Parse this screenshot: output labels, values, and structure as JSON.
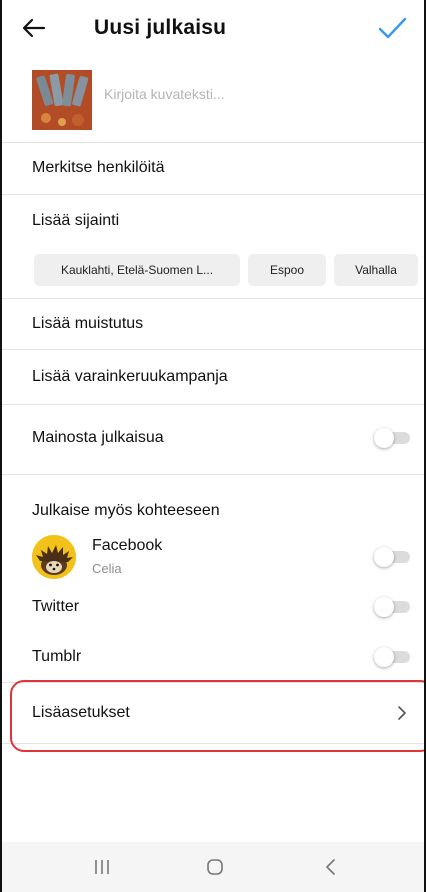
{
  "header": {
    "title": "Uusi julkaisu",
    "back_icon": "arrow-left-icon",
    "confirm_icon": "checkmark-icon",
    "accent_color": "#3897f0"
  },
  "caption": {
    "placeholder": "Kirjoita kuvateksti...",
    "value": ""
  },
  "rows": {
    "tag_people": "Merkitse henkilöitä",
    "add_location": "Lisää sijainti",
    "add_reminder": "Lisää muistutus",
    "add_fundraiser": "Lisää varainkeruukampanja",
    "promote_post": "Mainosta julkaisua",
    "advanced_settings": "Lisäasetukset"
  },
  "location_suggestions": [
    "Kauklahti, Etelä-Suomen L...",
    "Espoo",
    "Valhalla"
  ],
  "share_section": {
    "heading": "Julkaise myös kohteeseen",
    "facebook": {
      "label": "Facebook",
      "account": "Celia",
      "enabled": false
    },
    "twitter": {
      "label": "Twitter",
      "enabled": false
    },
    "tumblr": {
      "label": "Tumblr",
      "enabled": false
    }
  },
  "promote_enabled": false,
  "highlight_color": "#e0343a",
  "nav": [
    "recent-apps-icon",
    "home-icon",
    "back-icon"
  ]
}
